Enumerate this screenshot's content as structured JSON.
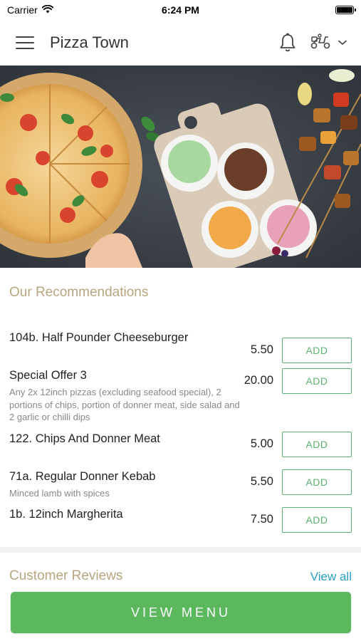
{
  "status_bar": {
    "carrier": "Carrier",
    "time": "6:24 PM"
  },
  "header": {
    "title": "Pizza Town",
    "icons": [
      "menu-icon",
      "bell-icon",
      "scooter-icon",
      "chevron-down-icon"
    ]
  },
  "recommendations": {
    "title": "Our Recommendations",
    "add_label": "ADD",
    "items": [
      {
        "name": "104b. Half Pounder Cheeseburger",
        "description": "",
        "price": "5.50"
      },
      {
        "name": "Special Offer 3",
        "description": "Any 2x 12inch pizzas (excluding seafood special), 2 portions of chips, portion of donner meat, side salad and 2 garlic or chilli dips",
        "price": "20.00"
      },
      {
        "name": "122. Chips And Donner Meat",
        "description": "",
        "price": "5.00"
      },
      {
        "name": "71a. Regular Donner Kebab",
        "description": "Minced lamb with spices",
        "price": "5.50"
      },
      {
        "name": "1b. 12inch Margherita",
        "description": "",
        "price": "7.50"
      }
    ]
  },
  "reviews": {
    "title": "Customer Reviews",
    "view_all": "View all"
  },
  "footer": {
    "view_menu": "VIEW MENU"
  },
  "colors": {
    "accent_green": "#5cb85c",
    "section_title": "#b7a57f",
    "link_blue": "#2a9dc6"
  }
}
